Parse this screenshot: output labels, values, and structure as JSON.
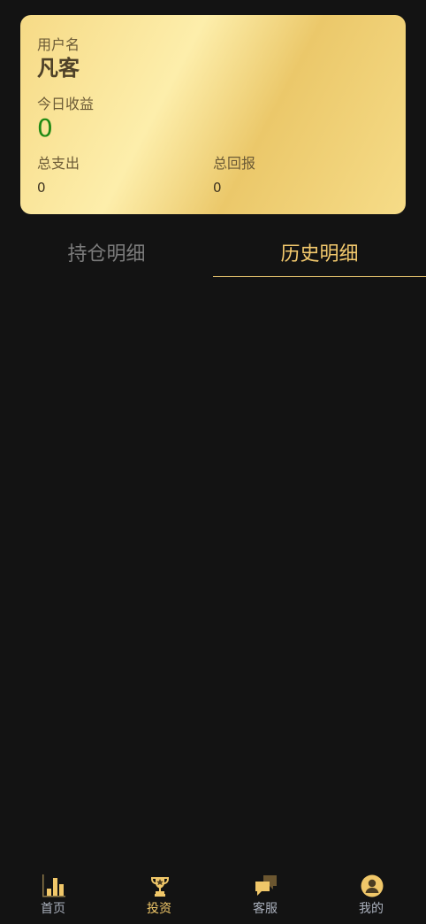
{
  "card": {
    "username_label": "用户名",
    "username": "凡客",
    "today_income_label": "今日收益",
    "today_income": "0",
    "total_expense_label": "总支出",
    "total_expense": "0",
    "total_return_label": "总回报",
    "total_return": "0"
  },
  "tabs": [
    {
      "label": "持仓明细",
      "active": false
    },
    {
      "label": "历史明细",
      "active": true
    }
  ],
  "nav": [
    {
      "label": "首页",
      "icon": "bar-chart-icon",
      "active": false
    },
    {
      "label": "投资",
      "icon": "trophy-icon",
      "active": true
    },
    {
      "label": "客服",
      "icon": "chat-bubbles-icon",
      "active": false
    },
    {
      "label": "我的",
      "icon": "user-avatar-icon",
      "active": false
    }
  ],
  "colors": {
    "background": "#131313",
    "accent": "#f0c769",
    "income_green": "#1f8a13"
  }
}
